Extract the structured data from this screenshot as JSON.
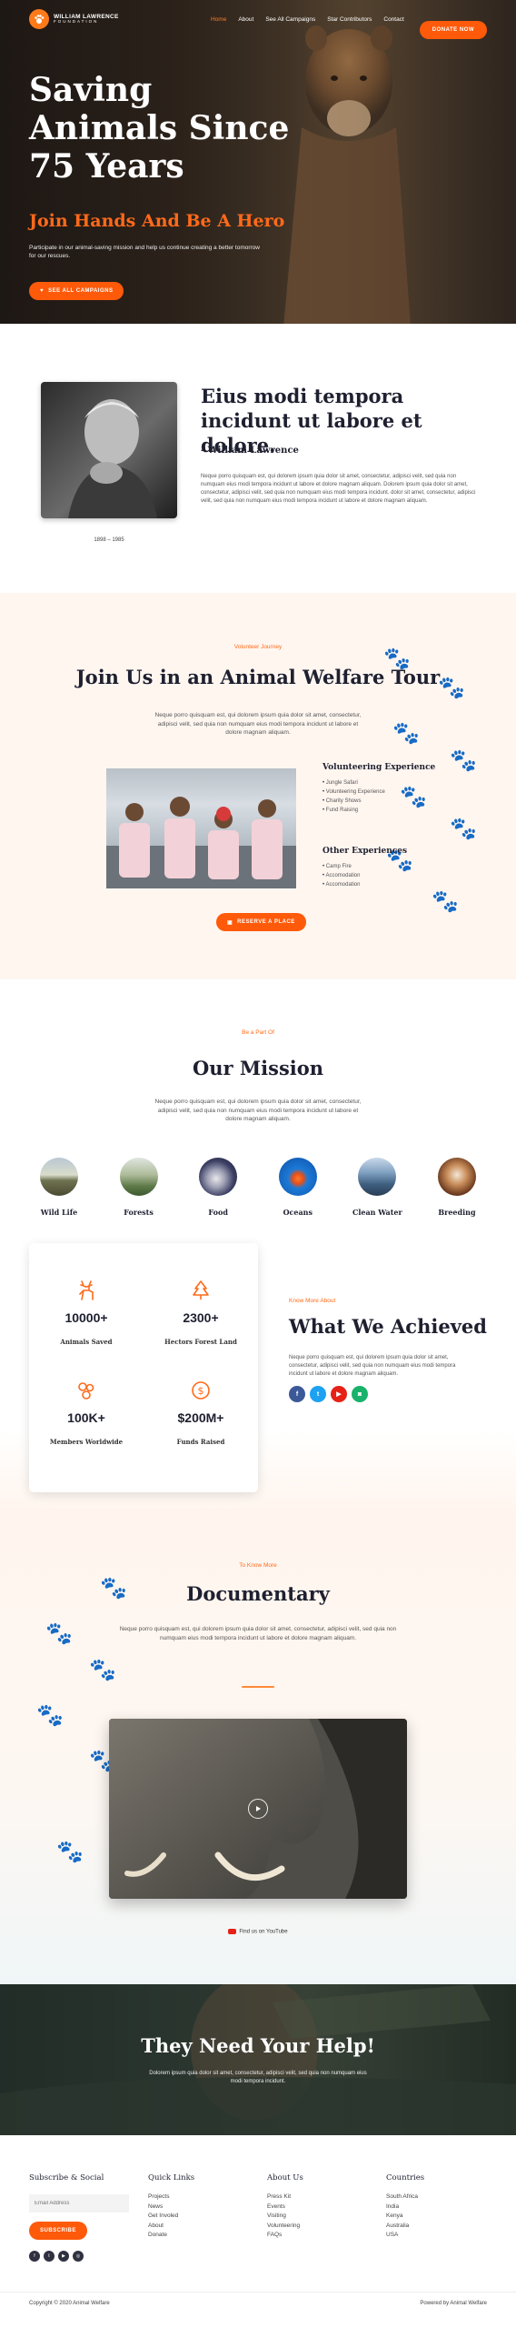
{
  "nav": {
    "brand_line1": "WILLIAM LAWRENCE",
    "brand_line2": "FOUNDATION",
    "items": [
      "Home",
      "About",
      "See All Campaigns",
      "Star Contributors",
      "Contact"
    ],
    "active_item": "Home",
    "donate_label": "DONATE NOW"
  },
  "hero": {
    "title": "Saving Animals Since 75 Years",
    "subtitle": "Join Hands And Be A Hero",
    "text": "Participate in our animal-saving mission and help us continue creating a better tomorrow for our rescues.",
    "button_label": "SEE ALL CAMPAIGNS"
  },
  "quote": {
    "heading": "Eius modi tempora incidunt ut labore et dolore.",
    "author": "- William Lawrence",
    "body": "Neque porro quisquam est, qui dolorem ipsum quia dolor sit amet, consectetur, adipisci velit, sed quia non numquam eius modi tempora incidunt ut labore et dolore magnam aliquam. Dolorem ipsum quia dolor sit amet, consectetur, adipisci velit, sed quia non numquam eius modi tempora incidunt. dolor sit amet, consectetur, adipisci velit, sed quia non numquam eius modi tempora incidunt ut labore et dolore magnam aliquam.",
    "photo_caption": "1898 – 1985"
  },
  "tour": {
    "kicker": "Volunteer Journey",
    "heading": "Join Us in an Animal Welfare Tour",
    "text": "Neque porro quisquam est, qui dolorem ipsum quia dolor sit amet, consectetur, adipisci velit, sed quia non numquam eius modi tempora incidunt ut labore et dolore magnam aliquam.",
    "list1_title": "Volunteering Experience",
    "list1": [
      "Jungle Safari",
      "Volunteering Experience",
      "Charity Shows",
      "Fund Raising"
    ],
    "list2_title": "Other Experiences",
    "list2": [
      "Camp Fire",
      "Accomodation",
      "Accomodation"
    ],
    "button_label": "RESERVE A PLACE"
  },
  "mission": {
    "kicker": "Be a Part Of",
    "heading": "Our Mission",
    "text": "Neque porro quisquam est, qui dolorem ipsum quia dolor sit amet, consectetur, adipisci velit, sed quia non numquam eius modi tempora incidunt ut labore et dolore magnam aliquam.",
    "categories": [
      "Wild Life",
      "Forests",
      "Food",
      "Oceans",
      "Clean Water",
      "Breeding"
    ]
  },
  "achieved": {
    "stats": [
      {
        "value": "10000+",
        "label": "Animals Saved",
        "icon": "deer-icon"
      },
      {
        "value": "2300+",
        "label": "Hectors Forest Land",
        "icon": "forest-icon"
      },
      {
        "value": "100K+",
        "label": "Members Worldwide",
        "icon": "members-icon"
      },
      {
        "value": "$200M+",
        "label": "Funds Raised",
        "icon": "coin-icon"
      }
    ],
    "kicker": "Know More About",
    "heading": "What We Achieved",
    "text": "Neque porro quisquam est, qui dolorem ipsum quia dolor sit amet, consectetur, adipisci velit, sed quia non numquam eius modi tempora incidunt ut labore et dolore magnam aliquam.",
    "social_colors": [
      "#3b5998",
      "#1da1f2",
      "#e62117",
      "#18b26a"
    ]
  },
  "documentary": {
    "kicker": "To Know More",
    "heading": "Documentary",
    "text": "Neque porro quisquam est, qui dolorem ipsum quia dolor sit amet, consectetur, adipisci velit, sed quia non numquam eius modi tempora incidunt ut labore et dolore magnam aliquam.",
    "youtube_label": "Find us on YouTube"
  },
  "help": {
    "heading": "They Need Your Help!",
    "text": "Dolorem ipsum quia dolor sit amet, consectetur, adipisci velit, sed quia non numquam eius modi tempora incidunt."
  },
  "footer": {
    "subscribe_title": "Subscribe & Social",
    "email_placeholder": "Email Address",
    "subscribe_label": "SUBSCRIBE",
    "quick_title": "Quick Links",
    "quick": [
      "Projects",
      "News",
      "Get Involed",
      "About",
      "Donate"
    ],
    "about_title": "About Us",
    "about": [
      "Press Kit",
      "Events",
      "Visiting",
      "Volunteering",
      "FAQs"
    ],
    "countries_title": "Countries",
    "countries": [
      "South Africa",
      "India",
      "Kenya",
      "Australia",
      "USA"
    ],
    "copyright": "Copyright © 2020 Animal Welfare",
    "powered": "Powered by Animal Welfare"
  },
  "colors": {
    "accent": "#ff5a0a",
    "dark": "#1e2030",
    "cream": "#fff6f0"
  }
}
